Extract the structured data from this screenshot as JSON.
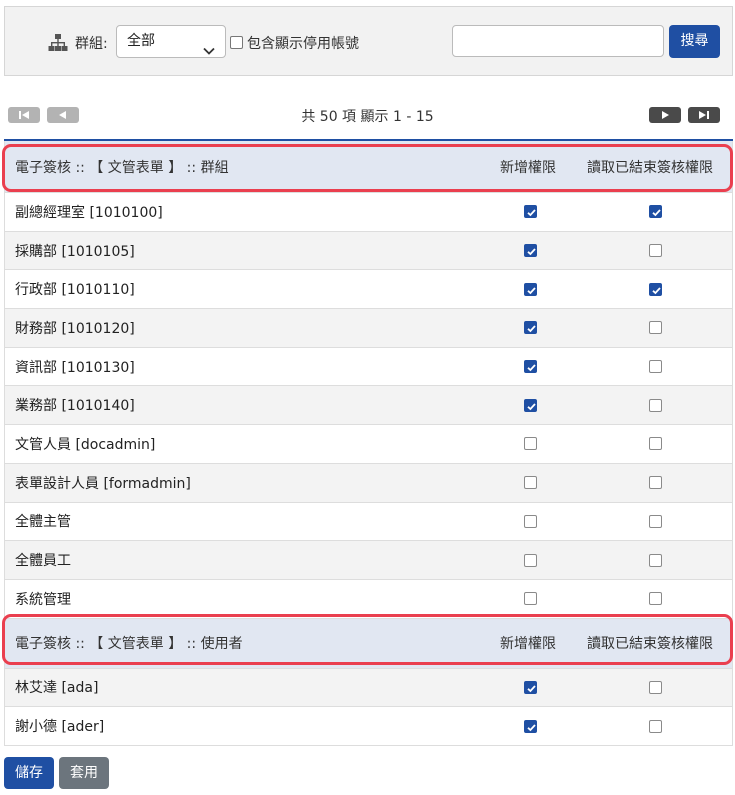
{
  "toolbar": {
    "group_label": "群組:",
    "group_select_value": "全部",
    "include_disabled_label": "包含顯示停用帳號",
    "search_value": "",
    "search_button": "搜尋"
  },
  "pager": {
    "info": "共 50 項 顯示 1 - 15"
  },
  "section_groups": {
    "title": "電子簽核 :: 【 文管表單 】 :: 群組",
    "col_add": "新增權限",
    "col_read": "讀取已結束簽核權限",
    "rows": [
      {
        "name": "副總經理室 [1010100]",
        "add": true,
        "read": true
      },
      {
        "name": "採購部 [1010105]",
        "add": true,
        "read": false
      },
      {
        "name": "行政部 [1010110]",
        "add": true,
        "read": true
      },
      {
        "name": "財務部 [1010120]",
        "add": true,
        "read": false
      },
      {
        "name": "資訊部 [1010130]",
        "add": true,
        "read": false
      },
      {
        "name": "業務部 [1010140]",
        "add": true,
        "read": false
      },
      {
        "name": "文管人員 [docadmin]",
        "add": false,
        "read": false
      },
      {
        "name": "表單設計人員 [formadmin]",
        "add": false,
        "read": false
      },
      {
        "name": "全體主管",
        "add": false,
        "read": false
      },
      {
        "name": "全體員工",
        "add": false,
        "read": false
      },
      {
        "name": "系統管理",
        "add": false,
        "read": false
      }
    ]
  },
  "section_users": {
    "title": "電子簽核 :: 【 文管表單 】 :: 使用者",
    "col_add": "新增權限",
    "col_read": "讀取已結束簽核權限",
    "rows": [
      {
        "name": "林艾達 [ada]",
        "add": true,
        "read": false
      },
      {
        "name": "謝小德 [ader]",
        "add": true,
        "read": false
      }
    ]
  },
  "footer": {
    "save_button": "儲存",
    "apply_button": "套用"
  },
  "colors": {
    "accent": "#1f4fa3",
    "highlight": "#ea3f4f"
  }
}
